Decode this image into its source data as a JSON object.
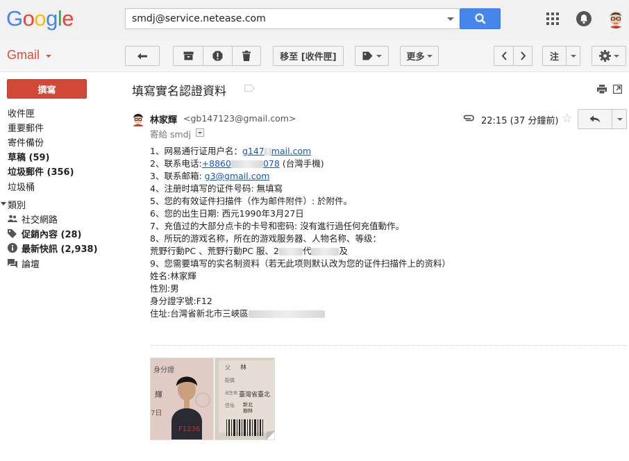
{
  "colors": {
    "brand_red": "#dd4b39",
    "compose_red": "#d14836",
    "search_blue": "#4787ed",
    "link_blue": "#1155cc"
  },
  "logo": {
    "letters": [
      "G",
      "o",
      "o",
      "g",
      "l",
      "e"
    ],
    "letter_colors": [
      "#4285f4",
      "#ea4335",
      "#fbbc05",
      "#4285f4",
      "#34a853",
      "#ea4335"
    ]
  },
  "search": {
    "value": "smdj@service.netease.com",
    "button_icon": "search-icon"
  },
  "header_icons": [
    "apps-grid-icon",
    "notifications-bell-icon",
    "account-avatar"
  ],
  "app": {
    "gmail_label": "Gmail"
  },
  "toolbar": {
    "back_icon": "arrow-left-icon",
    "archive_icon": "archive-icon",
    "spam_icon": "report-spam-icon",
    "delete_icon": "trash-icon",
    "move_to_label": "移至 [收件匣]",
    "labels_icon": "label-tag-icon",
    "more_label": "更多",
    "prev_icon": "chevron-left-icon",
    "next_icon": "chevron-right-icon",
    "input_tool_label": "注",
    "settings_icon": "gear-icon"
  },
  "sidebar": {
    "compose_label": "撰寫",
    "items": [
      {
        "label": "收件匣",
        "bold": false
      },
      {
        "label": "重要郵件",
        "bold": false
      },
      {
        "label": "寄件備份",
        "bold": false
      },
      {
        "label": "草稿 (59)",
        "bold": true
      },
      {
        "label": "垃圾郵件 (356)",
        "bold": true
      },
      {
        "label": "垃圾桶",
        "bold": false
      }
    ],
    "categories_label": "類別",
    "categories": [
      {
        "label": "社交網路",
        "icon": "people-icon",
        "bold": false
      },
      {
        "label": "促銷內容 (28)",
        "icon": "tag-icon",
        "bold": true
      },
      {
        "label": "最新快訊 (2,938)",
        "icon": "info-icon",
        "bold": true
      },
      {
        "label": "論壇",
        "icon": "forum-icon",
        "bold": false
      }
    ]
  },
  "email": {
    "subject": "填寫實名認證資料",
    "sender_name": "林家輝",
    "sender_email": "<gb147123@gmail.com>",
    "to_line": "寄給 smdj",
    "time": "22:15 (37 分鐘前)",
    "body": {
      "l1_label": "1、网易通行证用户名：",
      "l1_link": "g147",
      "l1_link_tail": "mail.com",
      "l2_label": "2、联系电话:",
      "l2_link": "+8860",
      "l2_link_tail": "078",
      "l2_suffix": "(台灣手機)",
      "l3_label": "3、联系邮箱: ",
      "l3_link": "g3@gmail.com",
      "l4": "4、注册时填写的证件号码: 無填寫",
      "l5": "5、您的有效证件扫描件（作为邮件附件）: 於附件。",
      "l6": "6、您的出生日期: 西元1990年3月27日",
      "l7": "7、充值过的大部分点卡的卡号和密码: 沒有進行過任何充值動作。",
      "l8": "8、所玩的游戏名称，所在的游戏服务器、人物名称、等级：",
      "l8b_a": "荒野行動PC 、荒野行動PC 服、2",
      "l8b_b": "代",
      "l8b_c": "及",
      "l9": "9、您需要填写的实名制资料（若无此项则默认改为您的证件扫描件上的资料）",
      "name": "姓名:林家輝",
      "gender": "性別:男",
      "id": "身分證字號:F12",
      "address": "住址:台灣省新北市三峽區"
    },
    "attachments": [
      {
        "name": "id-card-front",
        "text_lines": [
          "身分證",
          "輝",
          "7日",
          "F1236"
        ]
      },
      {
        "name": "id-card-back",
        "text_lines": [
          "父",
          "林",
          "配偶",
          "出生地",
          "臺灣省臺北",
          "住址",
          "新北",
          "樹林"
        ]
      }
    ]
  }
}
